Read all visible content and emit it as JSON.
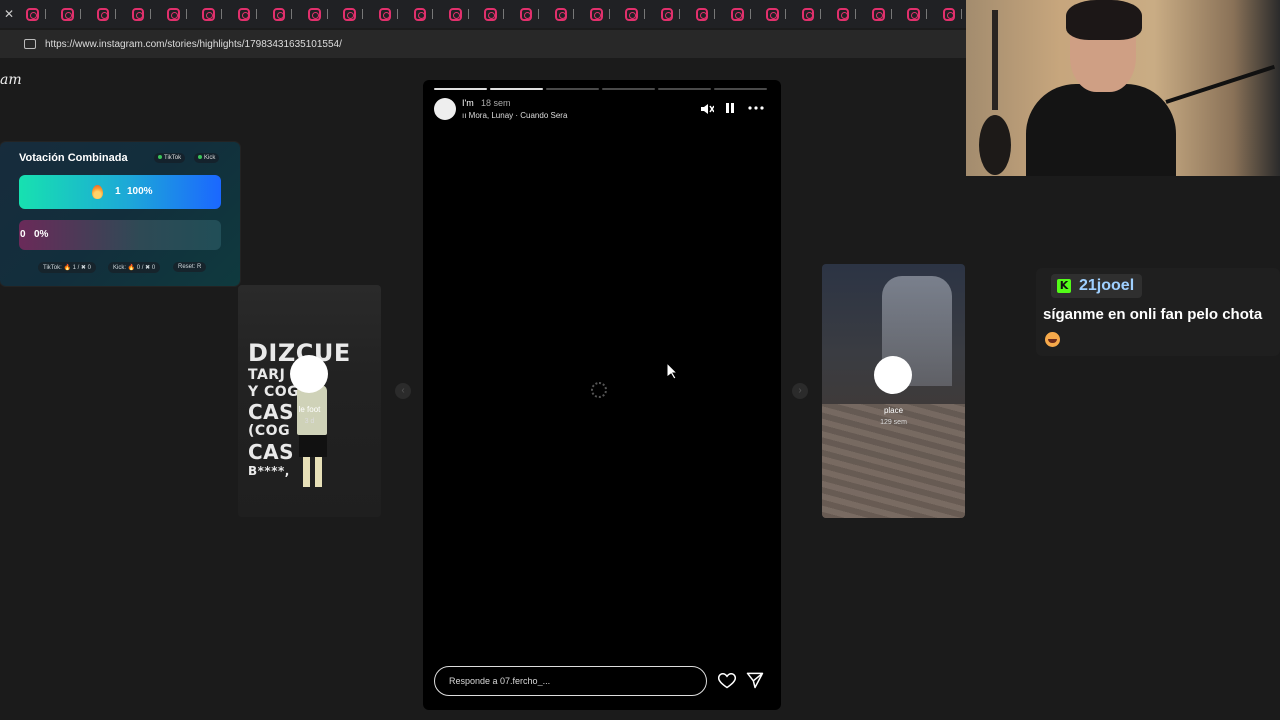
{
  "browser": {
    "url": "https://www.instagram.com/stories/highlights/17983431635101554/",
    "logo_text": "am",
    "tab_count": 27
  },
  "vote": {
    "title": "Votación Combinada",
    "tags": [
      "TikTok",
      "Kick"
    ],
    "option1": {
      "label": "1",
      "percent": "100%"
    },
    "option2": {
      "label": "0",
      "percent": "0%"
    },
    "footer": [
      "TikTok: 🔥 1 / ✖ 0",
      "Kick: 🔥 0 / ✖ 0",
      "Reset: R"
    ]
  },
  "left_card": {
    "lines": [
      "DIZCUE",
      "TARJ",
      "Y COG",
      "CAS",
      "(COG",
      "CAS",
      "B****,"
    ],
    "name": "le foot",
    "time": "3 d"
  },
  "right_card": {
    "name": "place",
    "time": "129 sem"
  },
  "story": {
    "username": "I'm",
    "time": "18 sem",
    "music": "Mora, Lunay · Cuando Sera",
    "reply_placeholder": "Responde a 07.fercho_...",
    "progress_segments": 6,
    "progress_filled_fraction": 1
  },
  "chat": {
    "username": "21jooel",
    "message": "síganme en onli fan pelo chota"
  },
  "colors": {
    "kick_green": "#53fc18",
    "instagram_pink": "#e1306c",
    "bar_gradient_start": "#17e1b0",
    "bar_gradient_end": "#1b67ff"
  }
}
